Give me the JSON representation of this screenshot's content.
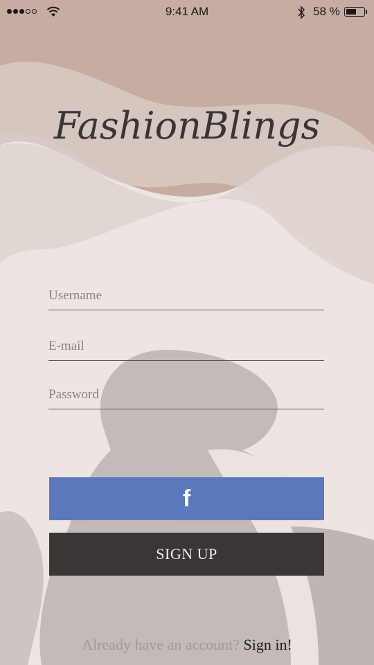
{
  "status_bar": {
    "time": "9:41 AM",
    "battery_percent": "58 %",
    "signal_bars_filled": 3,
    "signal_bars_total": 5,
    "icons": [
      "signal-dots-icon",
      "wifi-icon",
      "bluetooth-icon",
      "battery-icon"
    ]
  },
  "app": {
    "logo_text": "FashionBlings"
  },
  "form": {
    "username_placeholder": "Username",
    "email_placeholder": "E-mail",
    "password_placeholder": "Password"
  },
  "buttons": {
    "facebook_label": "f",
    "signup_label": "SIGN UP"
  },
  "footer": {
    "prompt": "Already have an account?",
    "signin_link": "Sign in!"
  },
  "colors": {
    "facebook_blue": "#5a78bb",
    "signup_dark": "#3a3636",
    "background_top": "#c7aca2",
    "background_body": "#ece5e2"
  }
}
